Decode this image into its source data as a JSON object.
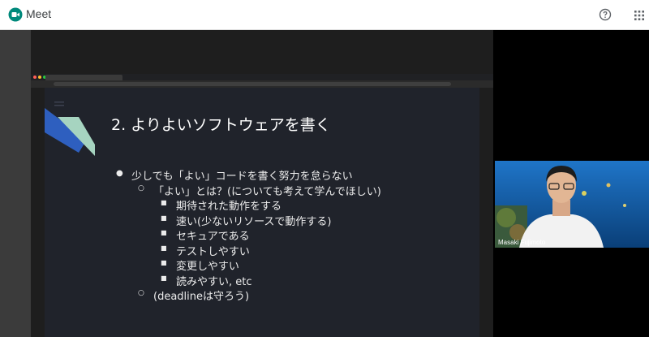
{
  "app": {
    "title": "Meet",
    "brand_color": "#00897b",
    "icons": {
      "logo": "meet-logo-icon",
      "help": "help-circle-icon",
      "apps": "apps-grid-icon"
    }
  },
  "slide": {
    "title": "2. よりよいソフトウェアを書く",
    "bullets": [
      {
        "level": 1,
        "marker": "●",
        "text": "少しでも「よい」コードを書く努力を怠らない"
      },
      {
        "level": 2,
        "marker": "○",
        "text": "「よい」とは？(についても考えて学んでほしい)"
      },
      {
        "level": 3,
        "marker": "■",
        "text": "期待された動作をする"
      },
      {
        "level": 3,
        "marker": "■",
        "text": "速い(少ないリソースで動作する)"
      },
      {
        "level": 3,
        "marker": "■",
        "text": "セキュアである"
      },
      {
        "level": 3,
        "marker": "■",
        "text": "テストしやすい"
      },
      {
        "level": 3,
        "marker": "■",
        "text": "変更しやすい"
      },
      {
        "level": 3,
        "marker": "■",
        "text": "読みやすい, etc"
      },
      {
        "level": 2,
        "marker": "○",
        "text": "(deadlineは守ろう)"
      }
    ],
    "background": "#20232b"
  },
  "video": {
    "participant_name": "Masaki Fujimoto"
  }
}
